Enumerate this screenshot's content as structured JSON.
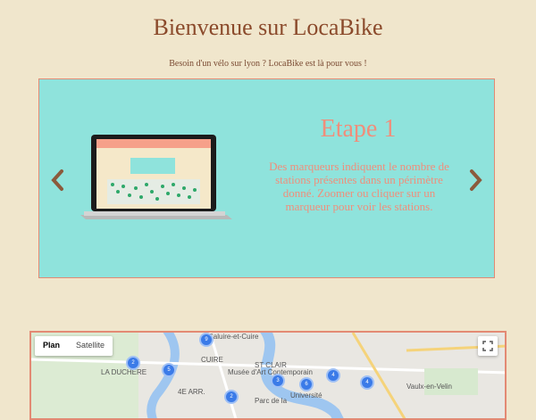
{
  "header": {
    "title": "Bienvenue sur LocaBike",
    "subtitle": "Besoin d'un vélo sur lyon ? LocaBike est là pour vous !"
  },
  "carousel": {
    "step_title": "Etape 1",
    "step_text": "Des marqueurs indiquent le nombre de stations présentes dans un périmètre donné. Zoomer ou cliquer sur un marqueur pour voir les stations.",
    "prev_icon": "chevron-left-icon",
    "next_icon": "chevron-right-icon"
  },
  "map": {
    "controls": [
      "Plan",
      "Satellite"
    ],
    "labels": [
      "Caluire-et-Cuire",
      "CUIRE",
      "ST CLAIR",
      "LA DUCHÈRE",
      "Musée d'Art Contemporain",
      "4E ARR.",
      "Parc de la",
      "Université",
      "Vaulx-en-Velin"
    ],
    "marker_counts": [
      2,
      5,
      9,
      3,
      6,
      4,
      4,
      2
    ]
  },
  "colors": {
    "background": "#f0e6cc",
    "accent": "#e38a74",
    "carousel_bg": "#8fe3dc",
    "title": "#8b4a2b"
  }
}
